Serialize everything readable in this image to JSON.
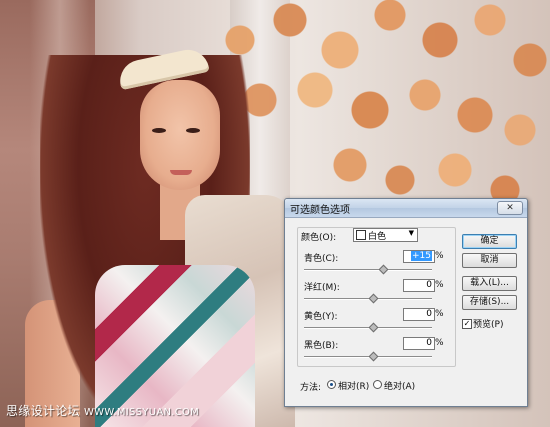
{
  "dialog": {
    "title": "可选颜色选项",
    "close_glyph": "✕",
    "colors": {
      "label": "颜色(O):",
      "selected": "白色",
      "swatch_color": "#ffffff",
      "arrow_glyph": "▼"
    },
    "sliders": [
      {
        "label": "青色(C):",
        "value": "+15",
        "percent": "%",
        "selected": true
      },
      {
        "label": "洋红(M):",
        "value": "0",
        "percent": "%",
        "selected": false
      },
      {
        "label": "黄色(Y):",
        "value": "0",
        "percent": "%",
        "selected": false
      },
      {
        "label": "黑色(B):",
        "value": "0",
        "percent": "%",
        "selected": false
      }
    ],
    "buttons": {
      "ok": "确定",
      "cancel": "取消",
      "load": "载入(L)...",
      "save": "存储(S)..."
    },
    "preview": {
      "label": "预览(P)",
      "checked": true,
      "check_glyph": "✓"
    },
    "method": {
      "label": "方法:",
      "options": [
        {
          "label": "相对(R)",
          "selected": true
        },
        {
          "label": "绝对(A)",
          "selected": false
        }
      ]
    },
    "colors_theme": {
      "title_bar": "#c2d3e7",
      "selection": "#3399ff"
    }
  },
  "watermark": {
    "text": "思缘设计论坛",
    "url": "WWW.MISSYUAN.COM"
  }
}
